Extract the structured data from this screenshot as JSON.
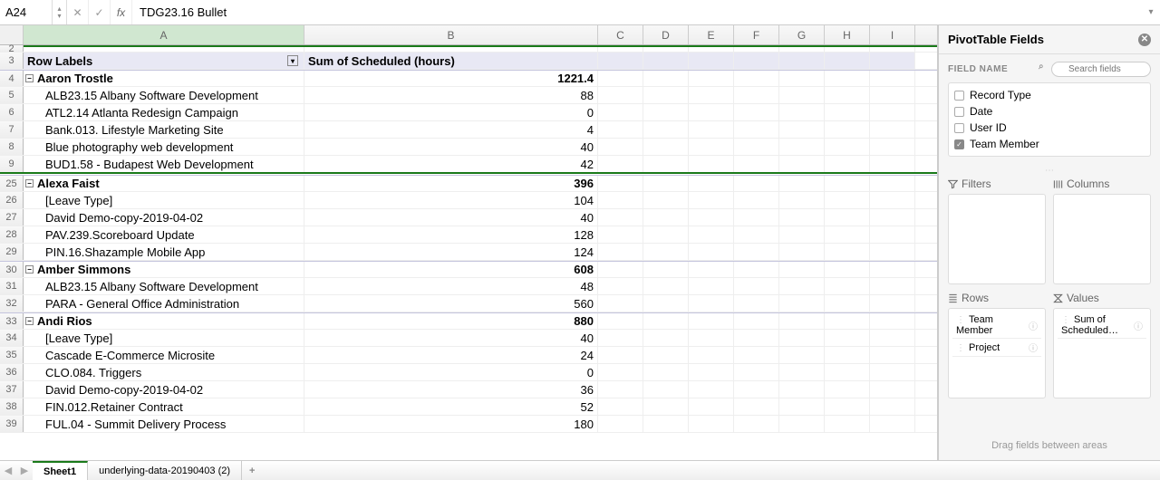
{
  "formula_bar": {
    "name_box": "A24",
    "formula": "TDG23.16 Bullet"
  },
  "columns": [
    "A",
    "B",
    "C",
    "D",
    "E",
    "F",
    "G",
    "H",
    "I"
  ],
  "col_widths_narrow": 50,
  "pivot_header": {
    "rowlabels": "Row Labels",
    "value": "Sum of Scheduled (hours)"
  },
  "search_placeholder": "Search fields",
  "rows": [
    {
      "n": "2",
      "type": "blank"
    },
    {
      "n": "3",
      "type": "hdr"
    },
    {
      "n": "4",
      "type": "total",
      "label": "Aaron Trostle",
      "value": "1221.4"
    },
    {
      "n": "5",
      "type": "item",
      "label": "ALB23.15 Albany Software Development",
      "value": "88"
    },
    {
      "n": "6",
      "type": "item",
      "label": "ATL2.14 Atlanta Redesign Campaign",
      "value": "0"
    },
    {
      "n": "7",
      "type": "item",
      "label": "Bank.013. Lifestyle Marketing Site",
      "value": "4"
    },
    {
      "n": "8",
      "type": "item",
      "label": "Blue photography web development",
      "value": "40"
    },
    {
      "n": "9",
      "type": "item",
      "label": "BUD1.58 - Budapest Web Development",
      "value": "42"
    },
    {
      "n": "25",
      "type": "total",
      "label": "Alexa Faist",
      "value": "396"
    },
    {
      "n": "26",
      "type": "item",
      "label": "[Leave Type]",
      "value": "104"
    },
    {
      "n": "27",
      "type": "item",
      "label": "David Demo-copy-2019-04-02",
      "value": "40"
    },
    {
      "n": "28",
      "type": "item",
      "label": "PAV.239.Scoreboard Update",
      "value": "128"
    },
    {
      "n": "29",
      "type": "item",
      "label": "PIN.16.Shazample Mobile App",
      "value": "124"
    },
    {
      "n": "30",
      "type": "total",
      "label": "Amber Simmons",
      "value": "608"
    },
    {
      "n": "31",
      "type": "item",
      "label": "ALB23.15 Albany Software Development",
      "value": "48"
    },
    {
      "n": "32",
      "type": "item",
      "label": "PARA - General Office Administration",
      "value": "560"
    },
    {
      "n": "33",
      "type": "total",
      "label": "Andi  Rios",
      "value": "880"
    },
    {
      "n": "34",
      "type": "item",
      "label": "[Leave Type]",
      "value": "40"
    },
    {
      "n": "35",
      "type": "item",
      "label": "Cascade E-Commerce Microsite",
      "value": "24"
    },
    {
      "n": "36",
      "type": "item",
      "label": "CLO.084. Triggers",
      "value": "0"
    },
    {
      "n": "37",
      "type": "item",
      "label": "David Demo-copy-2019-04-02",
      "value": "36"
    },
    {
      "n": "38",
      "type": "item",
      "label": "FIN.012.Retainer Contract",
      "value": "52"
    },
    {
      "n": "39",
      "type": "item",
      "label": "FUL.04 - Summit Delivery Process",
      "value": "180"
    }
  ],
  "green_line_after_row": "9",
  "pivot_panel": {
    "title": "PivotTable Fields",
    "fieldname_label": "FIELD NAME",
    "fields": [
      {
        "label": "Record Type",
        "checked": false
      },
      {
        "label": "Date",
        "checked": false
      },
      {
        "label": "User ID",
        "checked": false
      },
      {
        "label": "Team Member",
        "checked": true
      }
    ],
    "areas": {
      "filters": "Filters",
      "columns": "Columns",
      "rows": "Rows",
      "values": "Values"
    },
    "row_pills": [
      {
        "label": "Team Member"
      },
      {
        "label": "Project"
      }
    ],
    "value_pills": [
      {
        "label": "Sum of Scheduled…"
      }
    ],
    "footer": "Drag fields between areas"
  },
  "sheet_tabs": {
    "tabs": [
      {
        "label": "Sheet1",
        "active": true
      },
      {
        "label": "underlying-data-20190403 (2)",
        "active": false
      }
    ],
    "add": "+"
  }
}
